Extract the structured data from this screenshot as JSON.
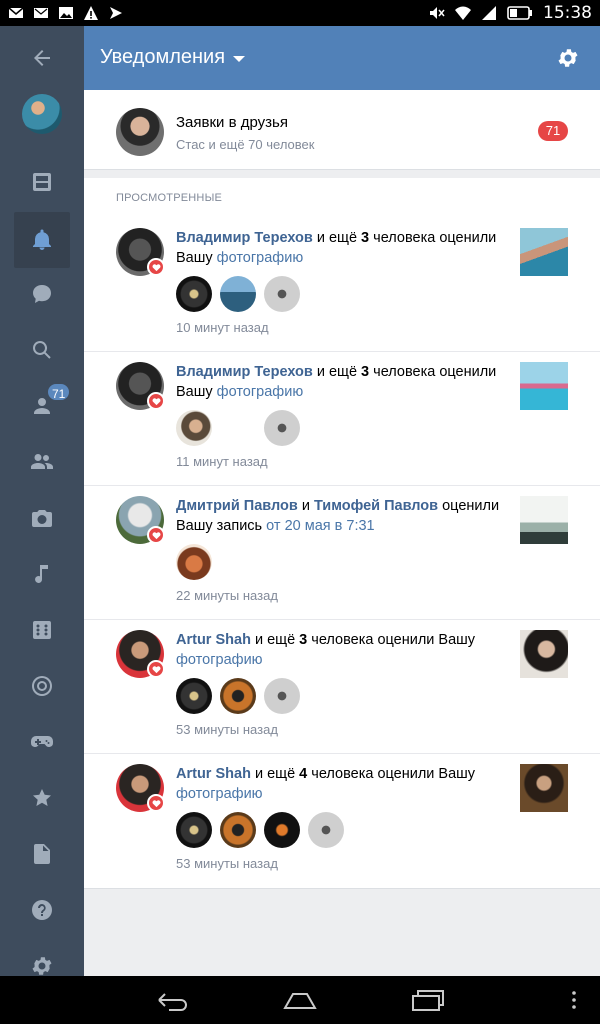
{
  "status_bar": {
    "time": "15:38",
    "left_icons": [
      "gmail-icon",
      "mail-icon",
      "image-icon",
      "warning-icon",
      "arrow-icon"
    ],
    "right_icons": [
      "mute-icon",
      "wifi-icon",
      "signal-icon",
      "battery-icon"
    ]
  },
  "rail": {
    "items": [
      {
        "name": "back",
        "icon": "back-arrow-icon"
      },
      {
        "name": "profile",
        "icon": "avatar"
      },
      {
        "name": "news",
        "icon": "news-icon"
      },
      {
        "name": "notifications",
        "icon": "bell-icon",
        "active": true
      },
      {
        "name": "messages",
        "icon": "chat-icon"
      },
      {
        "name": "search",
        "icon": "search-icon"
      },
      {
        "name": "friends",
        "icon": "user-icon",
        "badge": "71"
      },
      {
        "name": "groups",
        "icon": "users-icon"
      },
      {
        "name": "photos",
        "icon": "camera-icon"
      },
      {
        "name": "music",
        "icon": "music-icon"
      },
      {
        "name": "games",
        "icon": "dice-icon"
      },
      {
        "name": "live",
        "icon": "target-icon"
      },
      {
        "name": "gamepad",
        "icon": "gamepad-icon"
      },
      {
        "name": "favorites",
        "icon": "star-icon"
      },
      {
        "name": "documents",
        "icon": "document-icon"
      },
      {
        "name": "help",
        "icon": "help-icon"
      },
      {
        "name": "settings",
        "icon": "gear-icon"
      }
    ]
  },
  "header": {
    "title": "Уведомления"
  },
  "friend_requests": {
    "title": "Заявки в друзья",
    "subtitle": "Стас и ещё 70 человек",
    "badge": "71"
  },
  "section_label": "ПРОСМОТРЕННЫЕ",
  "notifications": [
    {
      "actor1": "Владимир Терехов",
      "mid1": " и ещё ",
      "count": "3",
      "mid2": " человека оценили Вашу ",
      "object": "фотографию",
      "time": "10 минут назад"
    },
    {
      "actor1": "Владимир Терехов",
      "mid1": " и ещё ",
      "count": "3",
      "mid2": " человека оценили Вашу ",
      "object": "фотографию",
      "time": "11 минут назад"
    },
    {
      "actor1": "Дмитрий Павлов",
      "mid1": " и ",
      "actor2": "Тимофей Павлов",
      "mid2": " оценили Вашу запись ",
      "object": "от 20 мая в 7:31",
      "time": "22 минуты назад"
    },
    {
      "actor1": "Artur Shah",
      "mid1": " и ещё ",
      "count": "3",
      "mid2": " человека оценили Вашу ",
      "object": "фотографию",
      "time": "53 минуты назад"
    },
    {
      "actor1": "Artur Shah",
      "mid1": " и ещё ",
      "count": "4",
      "mid2": " человека оценили Вашу ",
      "object": "фотографию",
      "time": "53 минуты назад"
    }
  ],
  "nav_bar": {
    "buttons": [
      "back-nav-icon",
      "home-nav-icon",
      "recents-nav-icon",
      "more-icon"
    ]
  },
  "colors": {
    "header": "#5181b8",
    "rail": "#3e4c5d",
    "link": "#3f6493",
    "badge": "#e64646"
  }
}
